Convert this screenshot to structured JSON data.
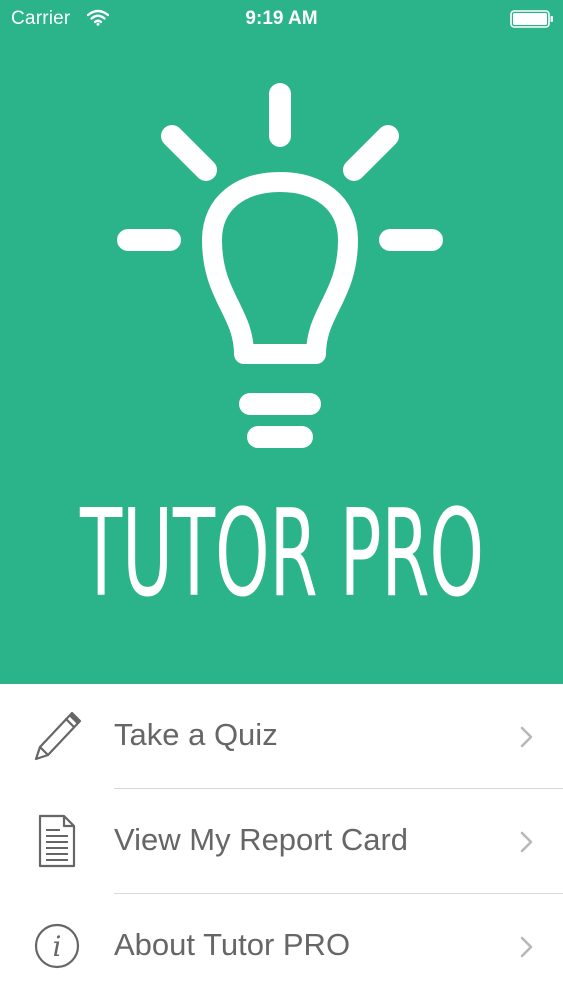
{
  "status_bar": {
    "carrier": "Carrier",
    "time": "9:19 AM",
    "wifi_icon": "wifi-icon",
    "battery_icon": "battery-icon"
  },
  "hero": {
    "background_color": "#2bb38a",
    "logo_icon": "lightbulb-icon",
    "wordmark": "TUTOR PRO"
  },
  "menu": {
    "items": [
      {
        "label": "Take a Quiz",
        "icon": "pencil-icon"
      },
      {
        "label": "View My Report Card",
        "icon": "document-icon"
      },
      {
        "label": "About Tutor PRO",
        "icon": "info-icon"
      }
    ],
    "chevron_icon": "chevron-right-icon"
  },
  "colors": {
    "accent": "#2bb38a",
    "menu_text": "#666666",
    "divider": "#d9d9d9"
  }
}
